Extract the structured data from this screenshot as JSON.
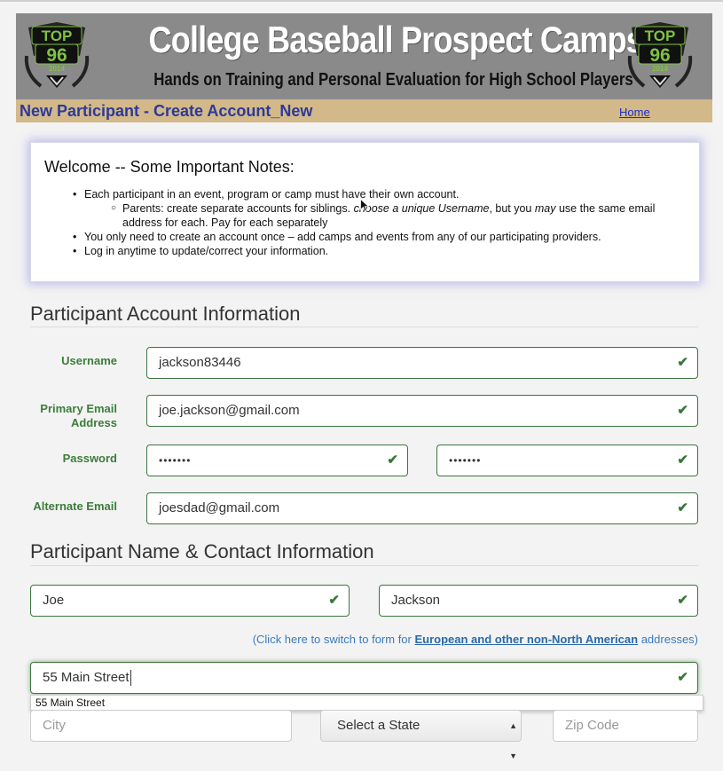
{
  "banner": {
    "logo": {
      "line1": "TOP",
      "line2": "96",
      "year": "2014"
    },
    "title": "College Baseball Prospect Camps",
    "subtitle": "Hands on Training and Personal Evaluation for High School Players"
  },
  "titlebar": {
    "title": "New Participant - Create Account_New",
    "home_link": "Home"
  },
  "notes": {
    "heading": "Welcome -- Some Important Notes:",
    "item1": "Each participant in an event, program or camp must have their own account.",
    "sub1_a": "Parents: create separate accounts for siblings. ",
    "sub1_b": "choose a unique Username",
    "sub1_c": ", but you ",
    "sub1_d": "may",
    "sub1_e": " use the same email address for each. Pay for each separately",
    "item2": "You only need to create an account once – add camps and events from any of our participating providers.",
    "item3": "Log in anytime to update/correct your information."
  },
  "account": {
    "heading": "Participant Account Information",
    "username_label": "Username",
    "username_value": "jackson83446",
    "email_label_1": "Primary Email",
    "email_label_2": "Address",
    "email_value": "joe.jackson@gmail.com",
    "password_label": "Password",
    "password_value": "•••••••",
    "password_confirm_value": "•••••••",
    "alt_email_label": "Alternate Email",
    "alt_email_value": "joesdad@gmail.com"
  },
  "contact": {
    "heading": "Participant Name & Contact Information",
    "first_name": "Joe",
    "last_name": "Jackson",
    "euro_pre": "(Click here to switch to form for ",
    "euro_link": "European and other non-North American",
    "euro_post": " addresses)",
    "street": "55 Main Street",
    "autocomplete_option": "55 Main Street",
    "city_placeholder": "City",
    "state_select": "Select a State",
    "zip_placeholder": "Zip Code"
  },
  "icons": {
    "check": "check-icon",
    "logo": "top96-logo-icon",
    "cursor": "mouse-cursor-icon"
  },
  "colors": {
    "banner": "#8a8a8a",
    "titlebar": "#d3b88a",
    "title_text": "#2b3a9a",
    "success": "#3c763d",
    "link": "#3a7bbf"
  }
}
